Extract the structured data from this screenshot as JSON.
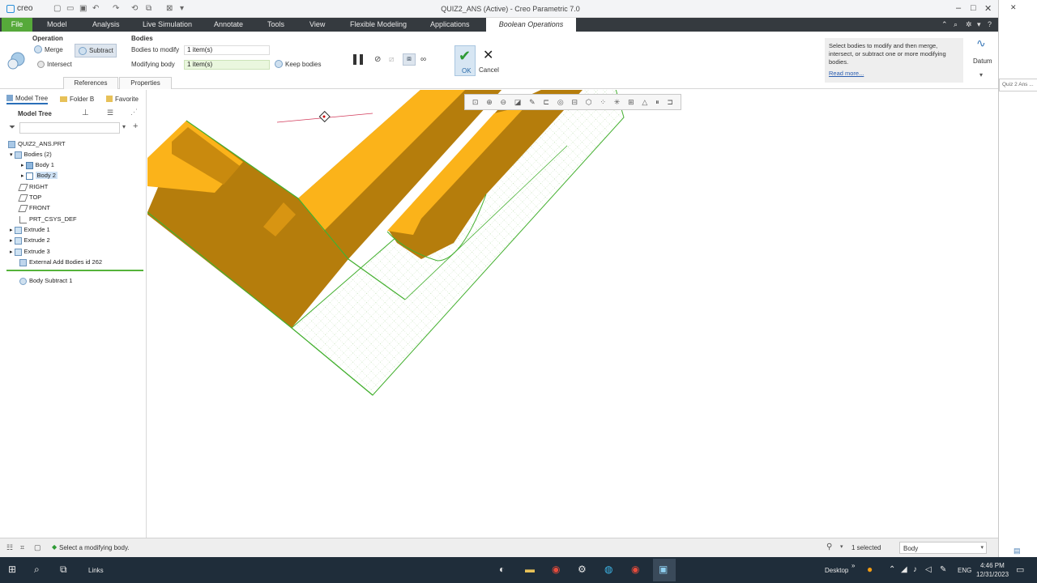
{
  "app": {
    "logo_text": "creo",
    "window_title": "QUIZ2_ANS (Active) - Creo Parametric 7.0",
    "window_controls": [
      "–",
      "□",
      "✕"
    ]
  },
  "ribbon_tabs": [
    "File",
    "Model",
    "Analysis",
    "Live Simulation",
    "Annotate",
    "Tools",
    "View",
    "Flexible Modeling",
    "Applications",
    "Boolean Operations"
  ],
  "ribbon": {
    "operation_label": "Operation",
    "merge_label": "Merge",
    "subtract_label": "Subtract",
    "intersect_label": "Intersect",
    "bodies_label": "Bodies",
    "bodies_to_modify_label": "Bodies to modify",
    "bodies_to_modify_value": "1 item(s)",
    "modifying_body_label": "Modifying body",
    "modifying_body_value": "1 item(s)",
    "keep_bodies_label": "Keep bodies",
    "references_tab": "References",
    "properties_tab": "Properties",
    "ok_label": "OK",
    "cancel_label": "Cancel",
    "help_text": "Select bodies to modify and then merge, intersect, or subtract one or more modifying bodies.",
    "help_link": "Read more...",
    "datum_label": "Datum"
  },
  "left_panel": {
    "tabs": [
      "Model Tree",
      "Folder B",
      "Favorite"
    ],
    "header": "Model Tree",
    "search_placeholder": "",
    "tree": [
      {
        "label": "QUIZ2_ANS.PRT",
        "icon": "part-icon"
      },
      {
        "label": "Bodies (2)",
        "icon": "bodies-icon"
      },
      {
        "label": "Body 1",
        "icon": "body-icon"
      },
      {
        "label": "Body 2",
        "icon": "body-icon"
      },
      {
        "label": "RIGHT",
        "icon": "datum-plane-icon"
      },
      {
        "label": "TOP",
        "icon": "datum-plane-icon"
      },
      {
        "label": "FRONT",
        "icon": "datum-plane-icon"
      },
      {
        "label": "PRT_CSYS_DEF",
        "icon": "csys-icon"
      },
      {
        "label": "Extrude 1",
        "icon": "extrude-icon"
      },
      {
        "label": "Extrude 2",
        "icon": "extrude-icon"
      },
      {
        "label": "Extrude 3",
        "icon": "extrude-icon"
      },
      {
        "label": "External Add Bodies id 262",
        "icon": "add-bodies-icon"
      },
      {
        "label": "Body Subtract 1",
        "icon": "body-subtract-icon"
      }
    ]
  },
  "status": {
    "message": "Select a modifying body.",
    "selected": "1 selected",
    "filter_value": "Body"
  },
  "right_strip_text": "Quiz 2 Ans ...",
  "taskbar": {
    "links_label": "Links",
    "desktop_label": "Desktop",
    "lang": "ENG",
    "time": "4:46 PM",
    "date": "12/31/2023"
  },
  "colors": {
    "accent_green": "#56a93a",
    "ribbon_dark": "#353a3f",
    "model_orange": "#fbb31a",
    "model_brown": "#b07a0a",
    "selection_green": "#44b030"
  }
}
